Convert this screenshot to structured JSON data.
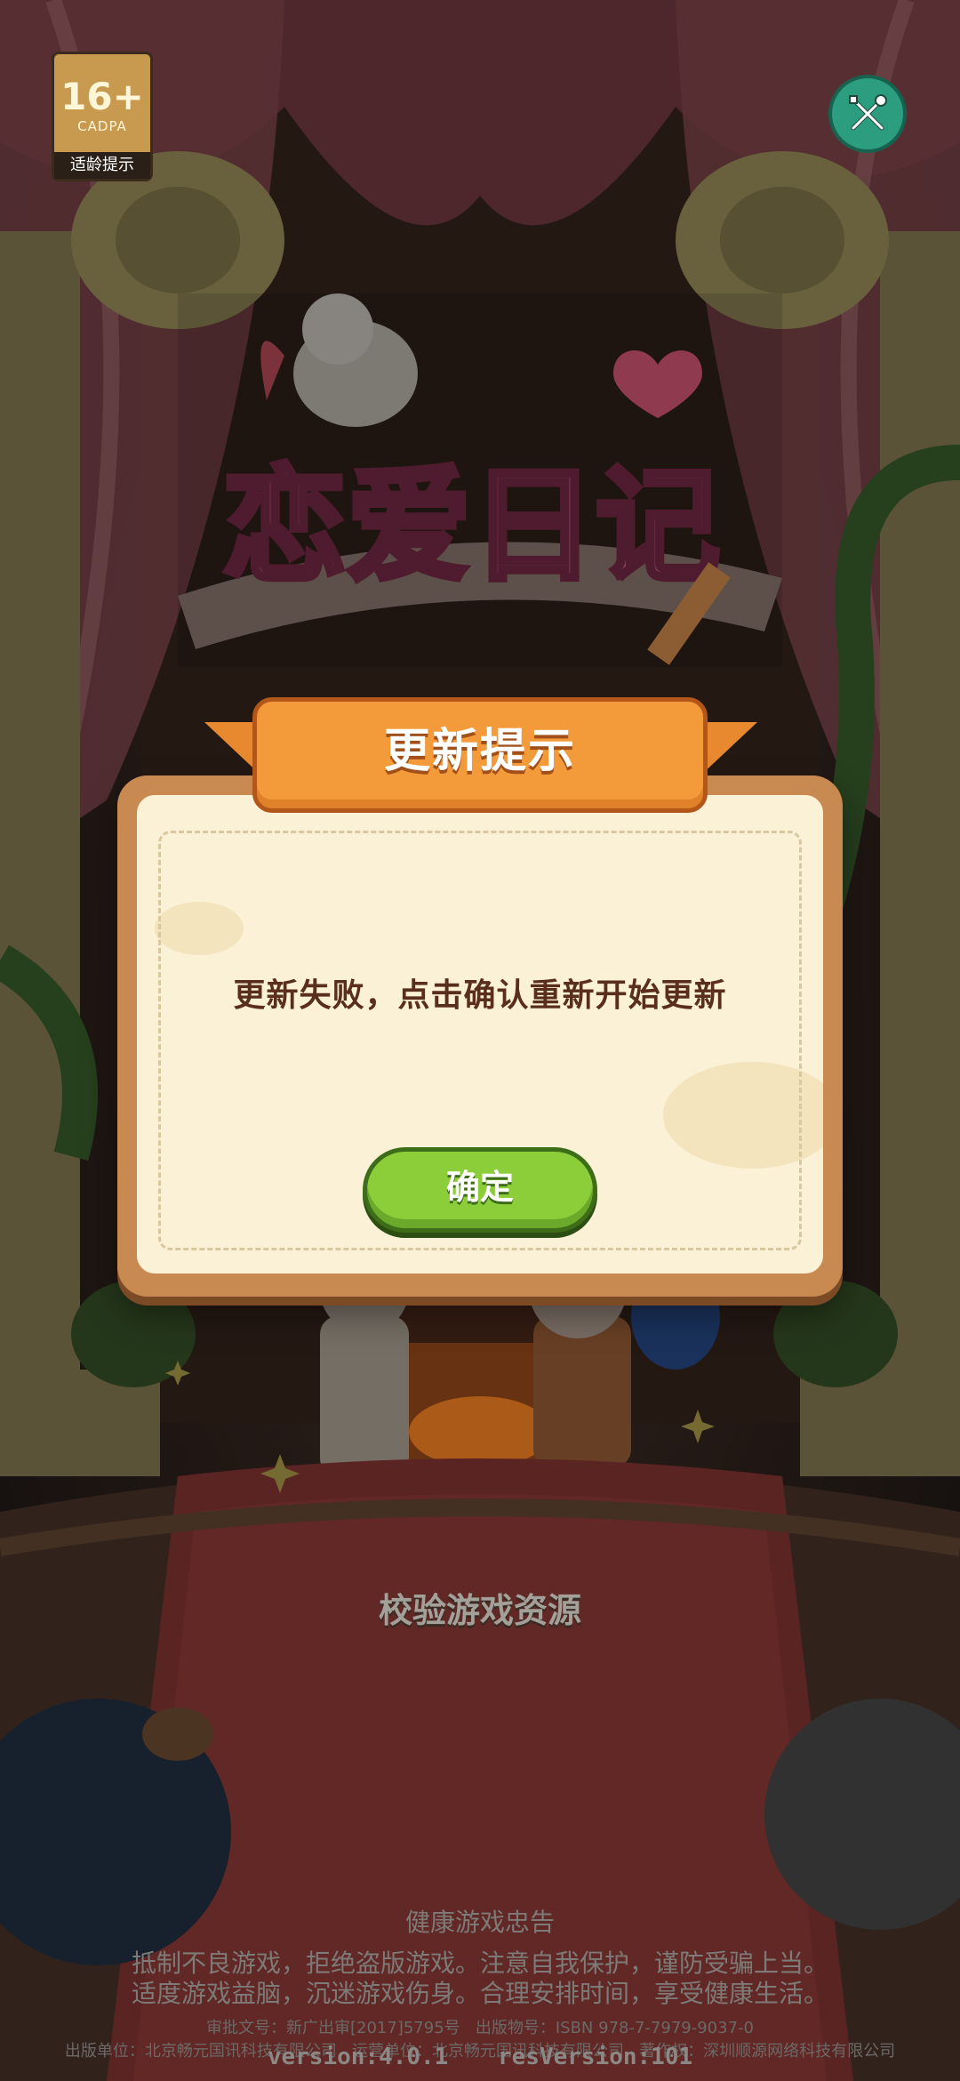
{
  "age_rating": {
    "age": "16+",
    "org": "CADPA",
    "tip": "适龄提示"
  },
  "logo": {
    "title": "恋爱日记"
  },
  "dialog": {
    "title": "更新提示",
    "message": "更新失败，点击确认重新开始更新",
    "confirm_label": "确定"
  },
  "status_text": "校验游戏资源",
  "footer": {
    "heading": "健康游戏忠告",
    "line1": "抵制不良游戏，拒绝盗版游戏。注意自我保护，谨防受骗上当。",
    "line2": "适度游戏益脑，沉迷游戏伤身。合理安排时间，享受健康生活。",
    "approval": "审批文号：新广出审[2017]5795号",
    "isbn": "出版物号：ISBN 978-7-7979-9037-0",
    "publisher": "出版单位：北京畅元国讯科技有限公司",
    "operator": "运营单位：北京畅元国讯科技有限公司",
    "copyright": "著作权：深圳顺源网络科技有限公司",
    "version": "version:4.0.1",
    "res_version": "resVersion:101"
  },
  "colors": {
    "dialog_frame": "#c98a52",
    "dialog_paper": "#fbf1d6",
    "ribbon": "#f39a3a",
    "confirm": "#8ccd3a",
    "settings": "#2c9d7e"
  },
  "icons": {
    "settings": "wrench-screwdriver-icon"
  }
}
